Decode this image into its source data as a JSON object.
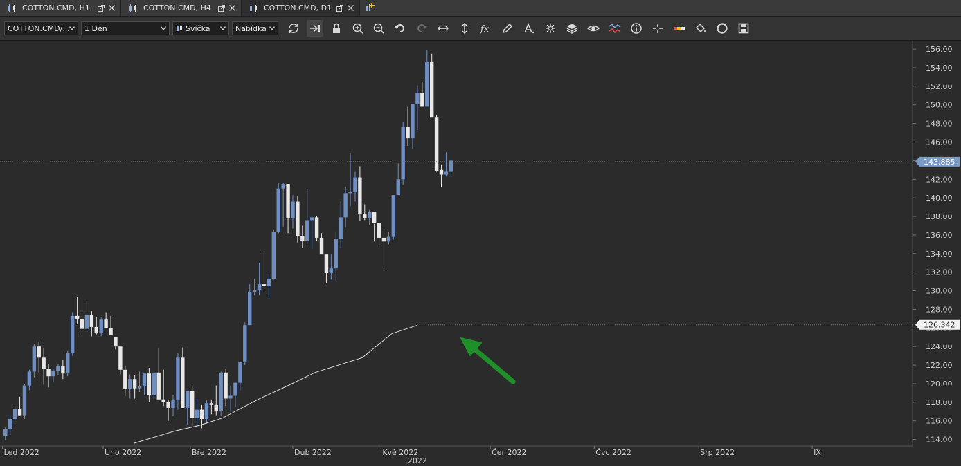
{
  "tabs": [
    {
      "label": "COTTON.CMD, H1",
      "active": false
    },
    {
      "label": "COTTON.CMD, H4",
      "active": false
    },
    {
      "label": "COTTON.CMD, D1",
      "active": true
    }
  ],
  "toolbar": {
    "symbol": "COTTON.CMD/...",
    "timeframe": "1 Den",
    "chart_type": "Svíčka",
    "price_type": "Nabídka",
    "tools": [
      "refresh-icon",
      "scroll-right-icon",
      "lock-icon",
      "zoom-in-icon",
      "zoom-out-icon",
      "undo-icon",
      "redo-icon",
      "horizontal-arrows-icon",
      "vertical-arrows-icon",
      "indicator-fx-icon",
      "pencil-icon",
      "text-icon",
      "crosshair-star-icon",
      "layers-icon",
      "eye-icon",
      "compare-icon",
      "info-icon",
      "cursor-cross-icon",
      "price-marker-icon",
      "paint-bucket-icon",
      "circle-icon",
      "save-icon"
    ],
    "pressed_tool": "scroll-right-icon"
  },
  "chart_data": {
    "type": "candlestick",
    "symbol": "COTTON.CMD",
    "timeframe": "D1",
    "ylim": [
      113.3,
      156.9
    ],
    "y_ticks": [
      "114.00",
      "116.00",
      "118.00",
      "120.00",
      "122.00",
      "124.00",
      "126.00",
      "128.00",
      "130.00",
      "132.00",
      "134.00",
      "136.00",
      "138.00",
      "140.00",
      "142.00",
      "144.00",
      "146.00",
      "148.00",
      "150.00",
      "152.00",
      "154.00",
      "156.00"
    ],
    "x_labels": [
      {
        "label": "Led 2022",
        "index": -0.6
      },
      {
        "label": "Uno 2022",
        "index": 20.4
      },
      {
        "label": "Bře 2022",
        "index": 38.6
      },
      {
        "label": "Dub 2022",
        "index": 60.0
      },
      {
        "label": "Kvě 2022",
        "index": 78.4
      },
      {
        "label": "Čer 2022",
        "index": 101.2
      },
      {
        "label": "Čvc 2022",
        "index": 122.9
      },
      {
        "label": "Srp 2022",
        "index": 144.7
      },
      {
        "label": "IX",
        "index": 168.4
      }
    ],
    "year_label": "2022",
    "year_label_index": 86.0,
    "current_price": 143.885,
    "current_price_label": "143.885",
    "ma_price": 126.342,
    "ma_price_label": "126.342",
    "candles": [
      [
        114.4,
        115.3,
        113.9,
        115.1
      ],
      [
        115.1,
        116.6,
        114.5,
        116.2
      ],
      [
        116.2,
        117.8,
        115.9,
        117.3
      ],
      [
        117.3,
        118.6,
        116.5,
        116.6
      ],
      [
        116.6,
        120.0,
        116.2,
        119.8
      ],
      [
        119.8,
        121.5,
        119.3,
        121.3
      ],
      [
        121.3,
        124.3,
        120.7,
        124.0
      ],
      [
        124.0,
        124.5,
        121.2,
        122.8
      ],
      [
        122.8,
        123.8,
        119.9,
        121.6
      ],
      [
        121.6,
        122.1,
        119.6,
        120.8
      ],
      [
        120.8,
        121.6,
        120.2,
        121.4
      ],
      [
        121.4,
        122.1,
        120.9,
        121.9
      ],
      [
        121.9,
        122.6,
        120.5,
        121.1
      ],
      [
        121.1,
        123.6,
        120.8,
        123.3
      ],
      [
        123.3,
        127.7,
        123.0,
        127.3
      ],
      [
        127.3,
        129.3,
        126.4,
        127.0
      ],
      [
        127.0,
        127.7,
        125.4,
        125.9
      ],
      [
        125.9,
        128.7,
        125.6,
        127.4
      ],
      [
        127.4,
        127.8,
        125.1,
        126.1
      ],
      [
        126.1,
        127.2,
        125.3,
        125.5
      ],
      [
        125.5,
        127.2,
        125.1,
        126.9
      ],
      [
        126.9,
        127.7,
        126.1,
        126.0
      ],
      [
        126.0,
        127.3,
        125.2,
        125.2
      ],
      [
        125.0,
        124.7,
        123.7,
        124.0
      ],
      [
        124.0,
        123.7,
        121.0,
        121.5
      ],
      [
        121.5,
        121.9,
        118.7,
        119.4
      ],
      [
        119.4,
        121.0,
        118.4,
        120.5
      ],
      [
        120.5,
        120.9,
        118.4,
        119.5
      ],
      [
        119.5,
        121.3,
        119.1,
        119.7
      ],
      [
        119.7,
        120.9,
        118.8,
        121.1
      ],
      [
        121.1,
        121.7,
        118.0,
        118.8
      ],
      [
        118.8,
        121.1,
        118.4,
        121.2
      ],
      [
        121.2,
        123.8,
        118.4,
        118.3
      ],
      [
        118.3,
        121.5,
        117.6,
        118.0
      ],
      [
        118.0,
        118.2,
        116.0,
        117.4
      ],
      [
        117.4,
        118.8,
        116.5,
        118.2
      ],
      [
        118.2,
        123.3,
        117.2,
        122.8
      ],
      [
        122.8,
        123.9,
        117.4,
        117.4
      ],
      [
        117.4,
        119.0,
        115.6,
        119.2
      ],
      [
        119.2,
        119.8,
        115.6,
        116.3
      ],
      [
        116.3,
        118.4,
        115.4,
        117.2
      ],
      [
        117.2,
        117.7,
        115.2,
        116.2
      ],
      [
        116.2,
        118.2,
        115.7,
        117.9
      ],
      [
        117.9,
        118.3,
        116.7,
        117.7
      ],
      [
        117.7,
        119.8,
        116.6,
        117.1
      ],
      [
        117.1,
        121.3,
        116.5,
        121.2
      ],
      [
        121.2,
        121.6,
        117.6,
        118.4
      ],
      [
        118.4,
        119.8,
        117.0,
        118.7
      ],
      [
        118.7,
        120.1,
        117.5,
        120.1
      ],
      [
        120.1,
        122.4,
        119.3,
        122.3
      ],
      [
        122.3,
        126.6,
        122.0,
        126.3
      ],
      [
        126.3,
        130.7,
        127.5,
        129.9
      ],
      [
        129.9,
        131.3,
        129.5,
        130.1
      ],
      [
        130.1,
        133.0,
        129.5,
        130.7
      ],
      [
        130.7,
        134.2,
        129.9,
        130.5
      ],
      [
        130.5,
        131.8,
        129.3,
        131.3
      ],
      [
        131.3,
        136.6,
        131.2,
        136.3
      ],
      [
        136.3,
        141.6,
        136.2,
        141.0
      ],
      [
        141.0,
        141.6,
        136.9,
        141.5
      ],
      [
        141.5,
        140.8,
        136.2,
        137.8
      ],
      [
        137.8,
        140.3,
        136.7,
        139.6
      ],
      [
        139.6,
        140.2,
        135.2,
        135.9
      ],
      [
        135.9,
        137.0,
        134.6,
        135.4
      ],
      [
        135.4,
        141.0,
        135.0,
        137.6
      ],
      [
        137.6,
        138.0,
        134.5,
        137.9
      ],
      [
        137.9,
        138.0,
        135.4,
        135.7
      ],
      [
        135.7,
        136.2,
        134.0,
        133.9
      ],
      [
        133.9,
        133.6,
        130.8,
        131.9
      ],
      [
        131.9,
        133.9,
        131.2,
        132.4
      ],
      [
        132.4,
        136.3,
        131.1,
        135.6
      ],
      [
        135.6,
        139.6,
        134.6,
        137.9
      ],
      [
        137.9,
        141.2,
        136.8,
        140.5
      ],
      [
        140.5,
        144.8,
        139.1,
        140.6
      ],
      [
        140.6,
        142.8,
        139.6,
        142.2
      ],
      [
        142.2,
        143.4,
        137.5,
        138.3
      ],
      [
        138.3,
        139.3,
        137.6,
        137.8
      ],
      [
        137.8,
        138.7,
        137.1,
        138.5
      ],
      [
        138.5,
        137.2,
        135.3,
        137.3
      ],
      [
        137.3,
        136.4,
        134.7,
        135.7
      ],
      [
        135.7,
        136.5,
        132.3,
        135.3
      ],
      [
        135.3,
        136.3,
        135.0,
        135.8
      ],
      [
        135.8,
        136.1,
        135.5,
        140.3
      ],
      [
        140.3,
        143.7,
        140.4,
        142.0
      ],
      [
        142.0,
        148.2,
        141.4,
        147.6
      ],
      [
        147.6,
        149.8,
        145.6,
        146.4
      ],
      [
        146.4,
        148.8,
        145.3,
        150.1
      ],
      [
        150.1,
        152.1,
        147.3,
        151.3
      ],
      [
        151.3,
        152.5,
        149.8,
        149.8
      ],
      [
        149.8,
        155.9,
        150.0,
        154.6
      ],
      [
        154.6,
        155.5,
        149.8,
        148.7
      ],
      [
        148.7,
        148.9,
        142.8,
        142.9
      ],
      [
        143.0,
        143.6,
        141.2,
        142.5
      ],
      [
        142.5,
        144.9,
        142.3,
        142.8
      ],
      [
        142.8,
        143.5,
        142.3,
        144.0
      ]
    ],
    "ma_series": [
      {
        "x": 26.9,
        "y": 113.6
      },
      {
        "x": 35.3,
        "y": 114.9
      },
      {
        "x": 40.4,
        "y": 115.5
      },
      {
        "x": 45.3,
        "y": 116.3
      },
      {
        "x": 52.7,
        "y": 118.3
      },
      {
        "x": 58.6,
        "y": 119.7
      },
      {
        "x": 64.6,
        "y": 121.2
      },
      {
        "x": 74.5,
        "y": 122.8
      },
      {
        "x": 80.7,
        "y": 125.4
      },
      {
        "x": 86.0,
        "y": 126.3
      }
    ],
    "annotation": {
      "type": "arrow",
      "color": "#1f8f2a"
    }
  },
  "colors": {
    "bull": "#6f8fc3",
    "bear": "#e8e8e8",
    "background": "#2b2b2b",
    "ma_line": "#dcdcdc",
    "price_label_bg": "#7b9cc7",
    "arrow": "#1f8f2a"
  }
}
